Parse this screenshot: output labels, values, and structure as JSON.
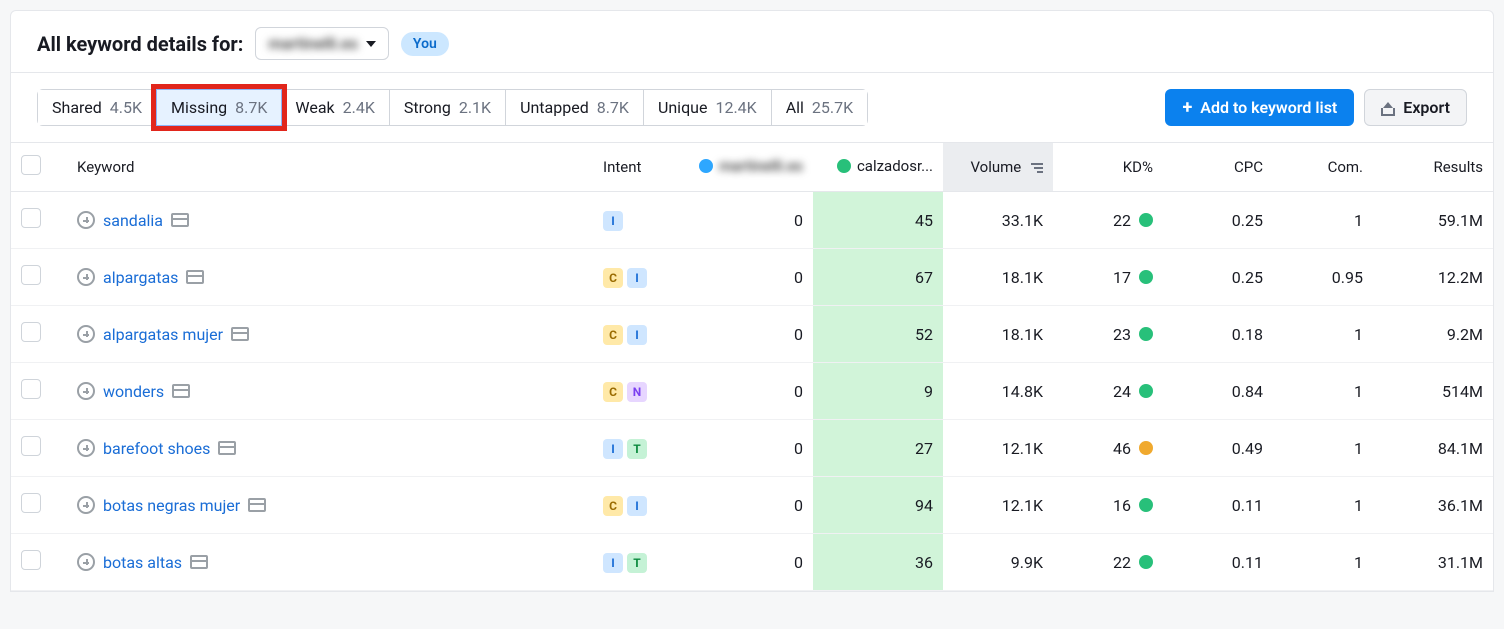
{
  "header": {
    "title": "All keyword details for:",
    "domain_redacted": "martinelli.es",
    "you_badge": "You"
  },
  "tabs": [
    {
      "label": "Shared",
      "count": "4.5K",
      "active": false,
      "highlight": false
    },
    {
      "label": "Missing",
      "count": "8.7K",
      "active": true,
      "highlight": true
    },
    {
      "label": "Weak",
      "count": "2.4K",
      "active": false,
      "highlight": false
    },
    {
      "label": "Strong",
      "count": "2.1K",
      "active": false,
      "highlight": false
    },
    {
      "label": "Untapped",
      "count": "8.7K",
      "active": false,
      "highlight": false
    },
    {
      "label": "Unique",
      "count": "12.4K",
      "active": false,
      "highlight": false
    },
    {
      "label": "All",
      "count": "25.7K",
      "active": false,
      "highlight": false
    }
  ],
  "actions": {
    "add_label": "Add to keyword list",
    "export_label": "Export"
  },
  "columns": {
    "keyword": "Keyword",
    "intent": "Intent",
    "competitor1_redacted": "martinelli.es",
    "competitor2": "calzadosr...",
    "volume": "Volume",
    "kd": "KD%",
    "cpc": "CPC",
    "com": "Com.",
    "results": "Results"
  },
  "rows": [
    {
      "keyword": "sandalia",
      "intents": [
        "I"
      ],
      "comp1": "0",
      "comp2": "45",
      "volume": "33.1K",
      "kd": "22",
      "kd_color": "green",
      "cpc": "0.25",
      "com": "1",
      "results": "59.1M"
    },
    {
      "keyword": "alpargatas",
      "intents": [
        "C",
        "I"
      ],
      "comp1": "0",
      "comp2": "67",
      "volume": "18.1K",
      "kd": "17",
      "kd_color": "green",
      "cpc": "0.25",
      "com": "0.95",
      "results": "12.2M"
    },
    {
      "keyword": "alpargatas mujer",
      "intents": [
        "C",
        "I"
      ],
      "comp1": "0",
      "comp2": "52",
      "volume": "18.1K",
      "kd": "23",
      "kd_color": "green",
      "cpc": "0.18",
      "com": "1",
      "results": "9.2M"
    },
    {
      "keyword": "wonders",
      "intents": [
        "C",
        "N"
      ],
      "comp1": "0",
      "comp2": "9",
      "volume": "14.8K",
      "kd": "24",
      "kd_color": "green",
      "cpc": "0.84",
      "com": "1",
      "results": "514M"
    },
    {
      "keyword": "barefoot shoes",
      "intents": [
        "I",
        "T"
      ],
      "comp1": "0",
      "comp2": "27",
      "volume": "12.1K",
      "kd": "46",
      "kd_color": "orange",
      "cpc": "0.49",
      "com": "1",
      "results": "84.1M"
    },
    {
      "keyword": "botas negras mujer",
      "intents": [
        "C",
        "I"
      ],
      "comp1": "0",
      "comp2": "94",
      "volume": "12.1K",
      "kd": "16",
      "kd_color": "green",
      "cpc": "0.11",
      "com": "1",
      "results": "36.1M"
    },
    {
      "keyword": "botas altas",
      "intents": [
        "I",
        "T"
      ],
      "comp1": "0",
      "comp2": "36",
      "volume": "9.9K",
      "kd": "22",
      "kd_color": "green",
      "cpc": "0.11",
      "com": "1",
      "results": "31.1M"
    }
  ]
}
